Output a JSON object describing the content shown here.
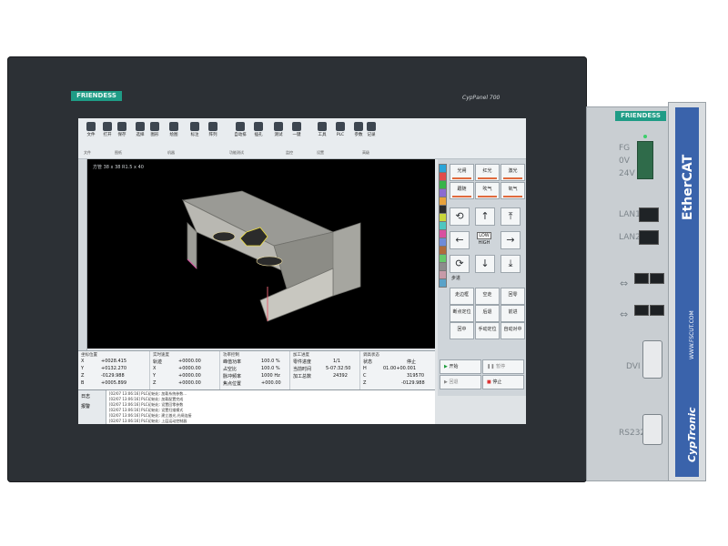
{
  "panel": {
    "brand": "FRIENDESS",
    "model": "CypPanel 700"
  },
  "screen": {
    "ribbon": {
      "buttons": [
        "文件",
        "打开",
        "保存",
        "选择",
        "图形",
        "绘图",
        "标注",
        "阵列",
        "自动排",
        "插孔",
        "测试",
        "一键",
        "工具",
        "PLC",
        "参数",
        "记录"
      ],
      "groups": [
        "文件",
        "图纸",
        "机器",
        "功能测试",
        "监控",
        "设置",
        "高级"
      ]
    },
    "canvas_caption": "方管 38 x 38 R1.5 x 40",
    "right_pane": {
      "top_buttons": [
        "光闸",
        "红光",
        "激光",
        "跟随",
        "吹气",
        "氧气"
      ],
      "speed_label": "LOW",
      "speed_text": "HIGH",
      "step_label": "步进",
      "nav_buttons": [
        "走边框",
        "空走",
        "回零",
        "断点定位",
        "后退",
        "前进",
        "回中",
        "手动定位",
        "自动对中"
      ],
      "swatch_colors": [
        "#2aa4d8",
        "#e14b4b",
        "#38b44a",
        "#8a6bd1",
        "#e9a23b",
        "#2b2b2b",
        "#c9d63b",
        "#4ec6c0",
        "#d84fa0",
        "#6e8bd9",
        "#b06b3a",
        "#66c96b",
        "#8c8c8c",
        "#c79aa8",
        "#5aa2c8"
      ]
    },
    "status": {
      "coords": {
        "header": "坐标位置",
        "rows": [
          {
            "axis": "X",
            "value": "+0028.415"
          },
          {
            "axis": "Y",
            "value": "+0132.270"
          },
          {
            "axis": "Z",
            "value": "-0129.988"
          },
          {
            "axis": "B",
            "value": "+0005.899"
          }
        ]
      },
      "follow": {
        "header": "实时速度",
        "rows": [
          {
            "label": "轨迹",
            "value": "+0000.00"
          },
          {
            "label": "X",
            "value": "+0000.00"
          },
          {
            "label": "Y",
            "value": "+0000.00"
          },
          {
            "label": "Z",
            "value": "+0000.00"
          }
        ]
      },
      "laser": {
        "header": "功率控制",
        "rows": [
          {
            "label": "峰值功率",
            "value": "100.0 %"
          },
          {
            "label": "占空比",
            "value": "100.0 %"
          },
          {
            "label": "脉冲频率",
            "value": "1000 Hz"
          },
          {
            "label": "焦点位置",
            "value": "+000.00"
          }
        ]
      },
      "progress": {
        "header": "加工进度",
        "rows": [
          {
            "label": "零件进度",
            "value": "1/1"
          },
          {
            "label": "当前时间",
            "value": "5-07:32:50"
          },
          {
            "label": "加工总数",
            "value": "24392"
          }
        ]
      },
      "height": {
        "header": "调高状态",
        "rows": [
          {
            "label": "状态",
            "value": "停止"
          },
          {
            "label": "H",
            "value": "01.00+00.001"
          },
          {
            "label": "C",
            "value": "319570"
          },
          {
            "label": "Z",
            "value": "-0129.988"
          }
        ]
      }
    },
    "controls": {
      "start": "开始",
      "pause": "暂停",
      "return": "回退",
      "stop": "停止"
    },
    "log": {
      "tabs": [
        "日志",
        "报警"
      ],
      "lines": [
        "[02/07 13:06:16] PLC初始化: 加载系统参数...",
        "[02/07 13:06:16] PLC初始化: 加载配置完成",
        "[02/07 13:06:16] PLC初始化: 设置回零参数",
        "[02/07 13:06:16] PLC初始化: 设置扫描模式",
        "[02/07 13:06:16] PLC初始化: 建立激光,光闸连接",
        "[02/07 13:06:16] PLC初始化: 上层运动控制器"
      ]
    }
  },
  "controller": {
    "brand": "FRIENDESS",
    "labels": {
      "fg": "FG",
      "v0": "0V",
      "v24": "24V",
      "lan1": "LAN1",
      "lan2": "LAN2",
      "dvi": "DVI",
      "rs232": "RS232"
    },
    "ethercat": "EtherCAT",
    "url": "WWW.FSCUT.COM",
    "logo": "CypTronic"
  }
}
